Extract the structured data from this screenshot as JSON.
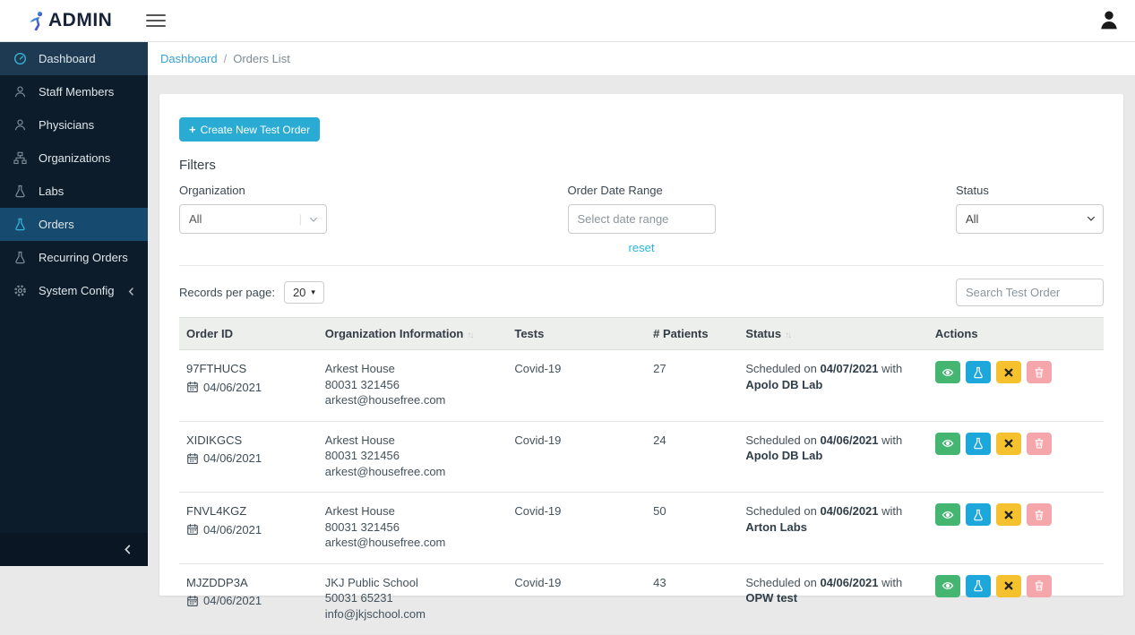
{
  "header": {
    "brand": "ADMIN"
  },
  "breadcrumb": {
    "separator": "/",
    "items": [
      {
        "label": "Dashboard"
      },
      {
        "label": "Orders List"
      }
    ]
  },
  "sidebar": {
    "items": [
      {
        "label": "Dashboard",
        "icon": "dashboard",
        "highlight": "dim",
        "chevron": false
      },
      {
        "label": "Staff Members",
        "icon": "user",
        "highlight": "none",
        "chevron": false
      },
      {
        "label": "Physicians",
        "icon": "user",
        "highlight": "none",
        "chevron": false
      },
      {
        "label": "Organizations",
        "icon": "sitemap",
        "highlight": "none",
        "chevron": false
      },
      {
        "label": "Labs",
        "icon": "flask",
        "highlight": "none",
        "chevron": false
      },
      {
        "label": "Orders",
        "icon": "flask",
        "highlight": "strong",
        "chevron": false
      },
      {
        "label": "Recurring Orders",
        "icon": "flask",
        "highlight": "none",
        "chevron": false
      },
      {
        "label": "System Config",
        "icon": "gear",
        "highlight": "none",
        "chevron": true
      }
    ]
  },
  "toolbar": {
    "create_button_label": "Create New Test Order"
  },
  "filters": {
    "title": "Filters",
    "organization": {
      "label": "Organization",
      "value": "All"
    },
    "date_range": {
      "label": "Order Date Range",
      "placeholder": "Select date range"
    },
    "status": {
      "label": "Status",
      "value": "All"
    },
    "reset_label": "reset"
  },
  "list_controls": {
    "records_per_page_label": "Records per page:",
    "records_per_page_value": "20",
    "search_placeholder": "Search Test Order"
  },
  "colors": {
    "primary": "#29abd4",
    "sidebar_bg": "#0d1c2b",
    "link": "#38a1d6",
    "reset_link": "#29b6d8"
  },
  "table": {
    "columns": [
      {
        "label": "Order ID",
        "sortable": false
      },
      {
        "label": "Organization Information",
        "sortable": true
      },
      {
        "label": "Tests",
        "sortable": false
      },
      {
        "label": "# Patients",
        "sortable": false
      },
      {
        "label": "Status",
        "sortable": true
      },
      {
        "label": "Actions",
        "sortable": false
      }
    ],
    "actions": [
      {
        "name": "view",
        "icon": "eye",
        "color": "#45b671",
        "icon_color": "#ffffff"
      },
      {
        "name": "lab",
        "icon": "flask",
        "color": "#1ea7da",
        "icon_color": "#ffffff"
      },
      {
        "name": "cancel",
        "icon": "x",
        "color": "#f6c12f",
        "icon_color": "#222222"
      },
      {
        "name": "delete",
        "icon": "trash",
        "color": "#f4a6aa",
        "icon_color": "#ffffff"
      }
    ],
    "rows": [
      {
        "order_id": "97FTHUCS",
        "order_date": "04/06/2021",
        "organization": {
          "name": "Arkest House",
          "phone": "80031 321456",
          "email": "arkest@housefree.com"
        },
        "tests": "Covid-19",
        "patients": "27",
        "status_parts": [
          {
            "text": "Scheduled on ",
            "bold": false
          },
          {
            "text": "04/07/2021",
            "bold": true
          },
          {
            "text": " with ",
            "bold": false
          },
          {
            "text": "Apolo DB Lab",
            "bold": true
          }
        ]
      },
      {
        "order_id": "XIDIKGCS",
        "order_date": "04/06/2021",
        "organization": {
          "name": "Arkest House",
          "phone": "80031 321456",
          "email": "arkest@housefree.com"
        },
        "tests": "Covid-19",
        "patients": "24",
        "status_parts": [
          {
            "text": "Scheduled on ",
            "bold": false
          },
          {
            "text": "04/06/2021",
            "bold": true
          },
          {
            "text": " with ",
            "bold": false
          },
          {
            "text": "Apolo DB Lab",
            "bold": true
          }
        ]
      },
      {
        "order_id": "FNVL4KGZ",
        "order_date": "04/06/2021",
        "organization": {
          "name": "Arkest House",
          "phone": "80031 321456",
          "email": "arkest@housefree.com"
        },
        "tests": "Covid-19",
        "patients": "50",
        "status_parts": [
          {
            "text": "Scheduled on ",
            "bold": false
          },
          {
            "text": "04/06/2021",
            "bold": true
          },
          {
            "text": " with ",
            "bold": false
          },
          {
            "text": "Arton Labs",
            "bold": true
          }
        ]
      },
      {
        "order_id": "MJZDDP3A",
        "order_date": "04/06/2021",
        "organization": {
          "name": "JKJ Public School",
          "phone": "50031 65231",
          "email": "info@jkjschool.com"
        },
        "tests": "Covid-19",
        "patients": "43",
        "status_parts": [
          {
            "text": "Scheduled on ",
            "bold": false
          },
          {
            "text": "04/06/2021",
            "bold": true
          },
          {
            "text": " with ",
            "bold": false
          },
          {
            "text": "OPW test",
            "bold": true
          }
        ]
      }
    ]
  }
}
